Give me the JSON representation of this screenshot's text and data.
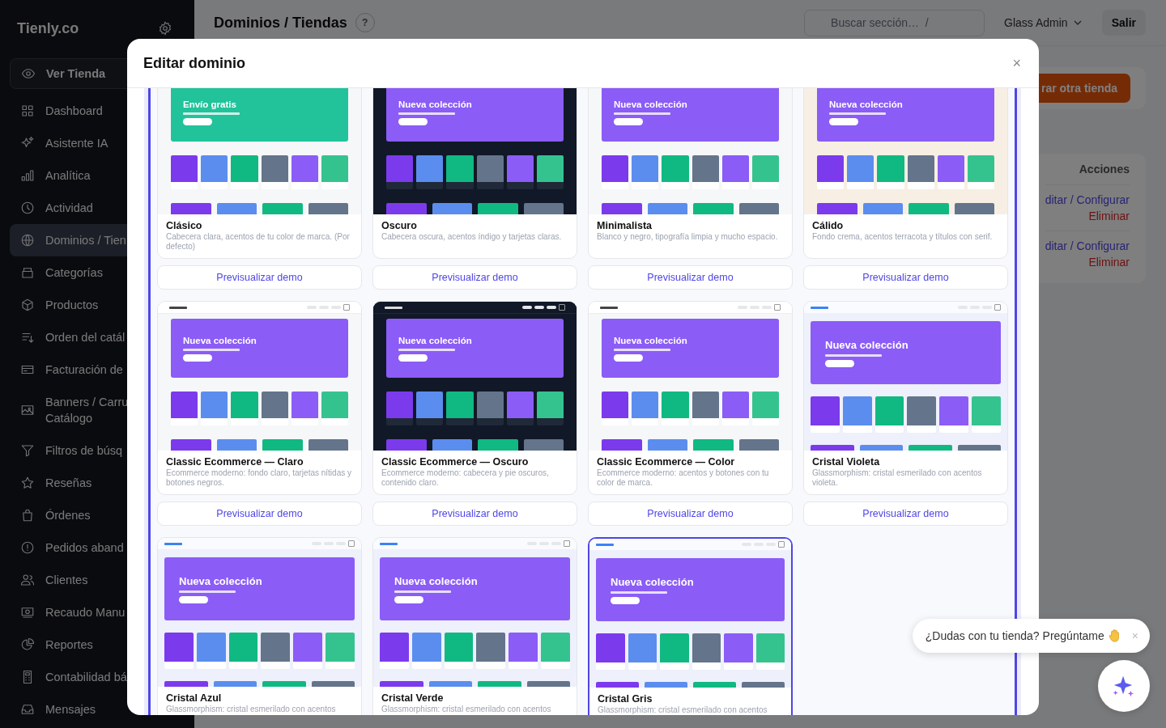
{
  "sidebar": {
    "logo": "Tienly.co",
    "items": [
      {
        "label": "Ver Tienda",
        "kind": "store-button",
        "selected": false
      },
      {
        "label": "Dashboard",
        "kind": "link",
        "selected": false
      },
      {
        "label": "Asistente IA",
        "kind": "link",
        "selected": false
      },
      {
        "label": "Analítica",
        "kind": "link",
        "selected": false
      },
      {
        "label": "Actividad",
        "kind": "link",
        "selected": false
      },
      {
        "label": "Dominios / Tien",
        "kind": "link",
        "selected": true
      },
      {
        "label": "Categorías",
        "kind": "link",
        "selected": false
      },
      {
        "label": "Productos",
        "kind": "link",
        "selected": false
      },
      {
        "label": "Orden del catál",
        "kind": "link",
        "selected": false
      },
      {
        "label": "Facturación de",
        "kind": "link",
        "selected": false
      },
      {
        "label": "Banners / Carru\nCatálogo",
        "kind": "link",
        "selected": false
      },
      {
        "label": "Filtros de búsq",
        "kind": "link",
        "selected": false
      },
      {
        "label": "Reseñas",
        "kind": "link",
        "selected": false
      },
      {
        "label": "Órdenes",
        "kind": "link",
        "selected": false
      },
      {
        "label": "Pedidos aband",
        "kind": "link",
        "selected": false
      },
      {
        "label": "Clientes",
        "kind": "link",
        "selected": false
      },
      {
        "label": "Recaudo Manu",
        "kind": "link",
        "selected": false
      },
      {
        "label": "Reportes",
        "kind": "link",
        "selected": false
      },
      {
        "label": "Contabilidad bá",
        "kind": "link",
        "selected": false
      },
      {
        "label": "Mensajes",
        "kind": "link",
        "selected": false
      }
    ]
  },
  "header": {
    "title": "Dominios / Tiendas",
    "help": "?",
    "search": {
      "placeholder": "Buscar sección…  /"
    },
    "user": "Glass Admin",
    "logout": "Salir"
  },
  "main": {
    "action_button": "rar otra tienda",
    "table": {
      "columns": [
        "Acciones"
      ],
      "rows": [
        {
          "edit": "ditar / Configurar",
          "delete": "Eliminar"
        },
        {
          "edit": "ditar / Configurar",
          "delete": "Eliminar"
        }
      ]
    }
  },
  "modal": {
    "title": "Editar dominio",
    "close": "×",
    "themes": [
      {
        "name": "Clásico",
        "description": "Cabecera clara, acentos de tu color de marca. (Por defecto)",
        "selected": false,
        "button": "Previsualizar demo",
        "preview": {
          "kind": "light",
          "color": "#22c39b",
          "hero_title": "Envío gratis"
        }
      },
      {
        "name": "Oscuro",
        "description": "Cabecera oscura, acentos índigo y tarjetas claras.",
        "selected": false,
        "button": "Previsualizar demo",
        "preview": {
          "kind": "dark",
          "color": "#8b5cf6",
          "hero_title": "Nueva colección"
        }
      },
      {
        "name": "Minimalista",
        "description": "Blanco y negro, tipografía limpia y mucho espacio.",
        "selected": false,
        "button": "Previsualizar demo",
        "preview": {
          "kind": "light",
          "color": "#8b5cf6",
          "hero_title": "Nueva colección"
        }
      },
      {
        "name": "Cálido",
        "description": "Fondo crema, acentos terracota y títulos con serif.",
        "selected": false,
        "button": "Previsualizar demo",
        "preview": {
          "kind": "cream",
          "color": "#8b5cf6",
          "hero_title": "Nueva colección"
        }
      },
      {
        "name": "Classic Ecommerce — Claro",
        "description": "Ecommerce moderno: fondo claro, tarjetas nítidas y botones negros.",
        "selected": false,
        "button": "Previsualizar demo",
        "preview": {
          "kind": "light",
          "color": "#8b5cf6",
          "hero_title": "Nueva colección"
        }
      },
      {
        "name": "Classic Ecommerce — Oscuro",
        "description": "Ecommerce moderno: cabecera y pie oscuros, contenido claro.",
        "selected": false,
        "button": "Previsualizar demo",
        "preview": {
          "kind": "dark",
          "color": "#8b5cf6",
          "hero_title": "Nueva colección"
        }
      },
      {
        "name": "Classic Ecommerce — Color",
        "description": "Ecommerce moderno: acentos y botones con tu color de marca.",
        "selected": false,
        "button": "Previsualizar demo",
        "preview": {
          "kind": "light",
          "color": "#8b5cf6",
          "hero_title": "Nueva colección"
        }
      },
      {
        "name": "Cristal Violeta",
        "description": "Glassmorphism: cristal esmerilado con acentos violeta.",
        "selected": false,
        "button": "Previsualizar demo",
        "preview": {
          "kind": "glass",
          "color": "#8b5cf6",
          "hero_title": "Nueva colección"
        }
      },
      {
        "name": "Cristal Azul",
        "description": "Glassmorphism: cristal esmerilado con acentos",
        "selected": false,
        "preview": {
          "kind": "glass",
          "color": "#8b5cf6",
          "hero_title": "Nueva colección"
        }
      },
      {
        "name": "Cristal Verde",
        "description": "Glassmorphism: cristal esmerilado con acentos",
        "selected": false,
        "preview": {
          "kind": "glass",
          "color": "#8b5cf6",
          "hero_title": "Nueva colección"
        }
      },
      {
        "name": "Cristal Gris",
        "description": "Glassmorphism: cristal esmerilado con acentos",
        "selected": true,
        "preview": {
          "kind": "glass",
          "color": "#8b5cf6",
          "hero_title": "Nueva colección"
        }
      }
    ]
  },
  "chat": {
    "message": "¿Dudas con tu tienda? Pregúntame",
    "close": "×"
  }
}
